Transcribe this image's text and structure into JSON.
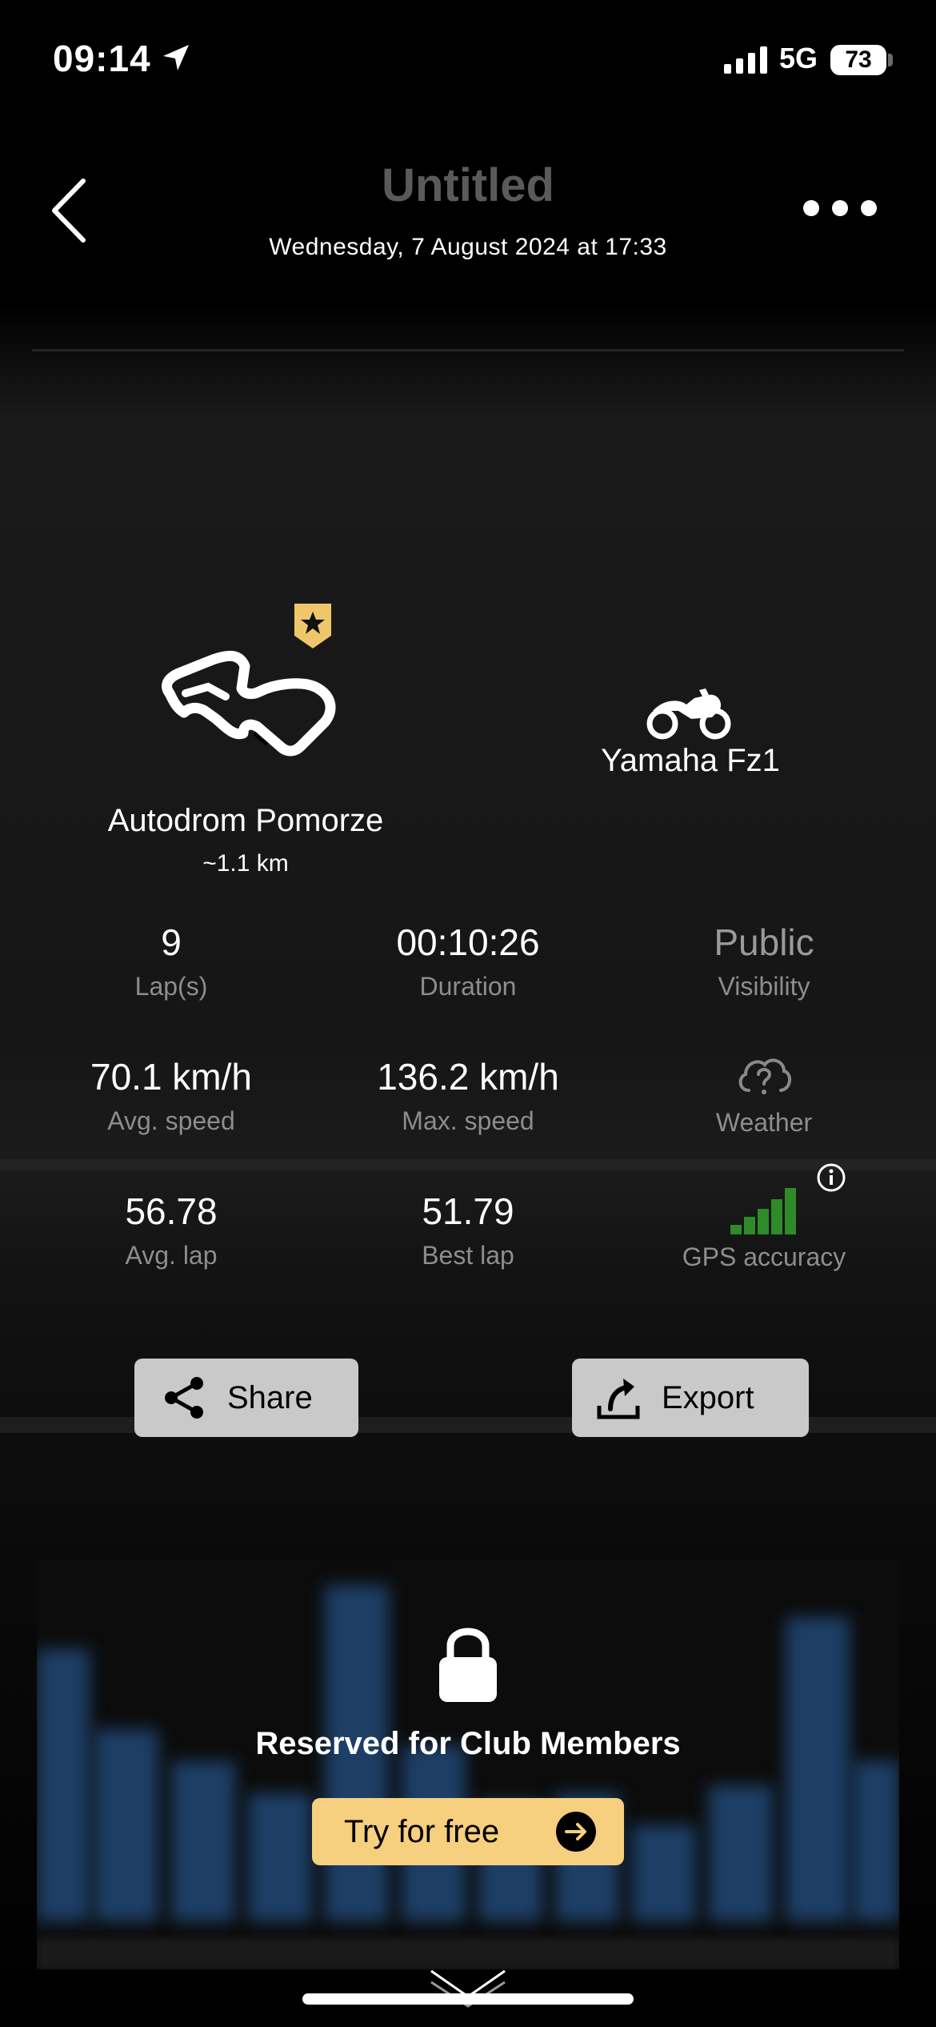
{
  "status_bar": {
    "time": "09:14",
    "network": "5G",
    "battery": "73"
  },
  "header": {
    "title": "Untitled",
    "subtitle": "Wednesday, 7 August 2024 at 17:33"
  },
  "track": {
    "name": "Autodrom Pomorze",
    "length": "~1.1 km"
  },
  "bike": {
    "name": "Yamaha Fz1"
  },
  "stats": {
    "laps": {
      "value": "9",
      "label": "Lap(s)"
    },
    "duration": {
      "value": "00:10:26",
      "label": "Duration"
    },
    "visibility": {
      "value": "Public",
      "label": "Visibility"
    },
    "avg_speed": {
      "value": "70.1 km/h",
      "label": "Avg. speed"
    },
    "max_speed": {
      "value": "136.2 km/h",
      "label": "Max. speed"
    },
    "weather": {
      "label": "Weather",
      "icon": "cloud-question-icon"
    },
    "avg_lap": {
      "value": "56.78",
      "label": "Avg. lap"
    },
    "best_lap": {
      "value": "51.79",
      "label": "Best lap"
    },
    "gps": {
      "label": "GPS accuracy",
      "icon": "signal-bars-icon",
      "level_fraction": 1.0
    }
  },
  "actions": {
    "share_label": "Share",
    "export_label": "Export"
  },
  "locked": {
    "text": "Reserved for Club Members",
    "cta_label": "Try for free"
  },
  "colors": {
    "accent_gold": "#f6cf7f",
    "badge_gold": "#f0c66a",
    "gps_green": "#2f8a2a",
    "chart_blue": "#1d3f66"
  }
}
